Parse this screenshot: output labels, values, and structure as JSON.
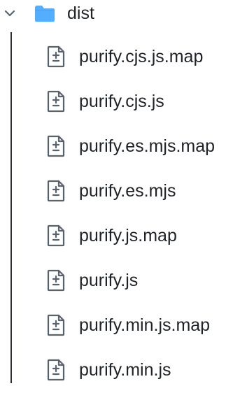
{
  "folder": {
    "name": "dist",
    "expanded": true,
    "icon": "folder-icon",
    "chevron_icon": "chevron-down-icon",
    "color": "#54aeff"
  },
  "files": [
    {
      "name": "purify.cjs.js.map",
      "icon": "file-diff-icon"
    },
    {
      "name": "purify.cjs.js",
      "icon": "file-diff-icon"
    },
    {
      "name": "purify.es.mjs.map",
      "icon": "file-diff-icon"
    },
    {
      "name": "purify.es.mjs",
      "icon": "file-diff-icon"
    },
    {
      "name": "purify.js.map",
      "icon": "file-diff-icon"
    },
    {
      "name": "purify.js",
      "icon": "file-diff-icon"
    },
    {
      "name": "purify.min.js.map",
      "icon": "file-diff-icon"
    },
    {
      "name": "purify.min.js",
      "icon": "file-diff-icon"
    }
  ],
  "colors": {
    "text": "#1f2328",
    "icon": "#59636e",
    "guide": "#2b2f33"
  }
}
